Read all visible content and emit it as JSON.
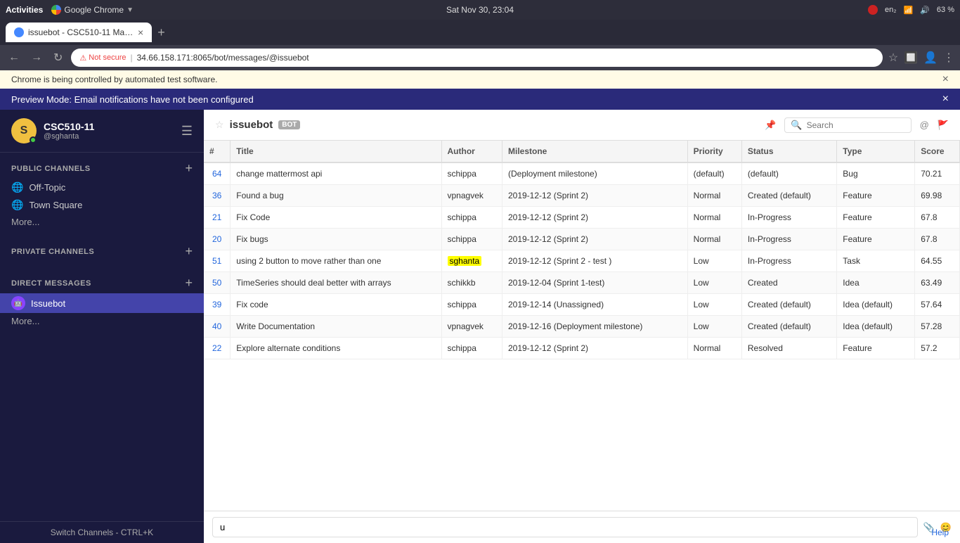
{
  "os": {
    "activities": "Activities",
    "browser_name": "Google Chrome",
    "datetime": "Sat Nov 30, 23:04",
    "battery": "63 %",
    "language": "en₂"
  },
  "browser": {
    "tab_title": "issuebot - CSC510-11 Mat...",
    "tab_close": "×",
    "new_tab": "+",
    "back": "←",
    "forward": "→",
    "reload": "↻",
    "not_secure_label": "Not secure",
    "url": "34.66.158.171:8065/bot/messages/@issuebot",
    "warning_icon": "⚠",
    "separator": "|"
  },
  "notifications": {
    "automation_text": "Chrome is being controlled by automated test software.",
    "automation_close": "×",
    "preview_text": "Preview Mode: Email notifications have not been configured",
    "preview_close": "×"
  },
  "sidebar": {
    "workspace_name": "CSC510-11",
    "username": "@sghanta",
    "avatar_letter": "S",
    "hamburger": "☰",
    "public_channels_label": "PUBLIC CHANNELS",
    "channels": [
      {
        "icon": "🌐",
        "name": "Off-Topic"
      },
      {
        "icon": "🌐",
        "name": "Town Square"
      }
    ],
    "more_label": "More...",
    "private_channels_label": "PRIVATE CHANNELS",
    "direct_messages_label": "DIRECT MESSAGES",
    "direct_messages": [
      {
        "name": "Issuebot",
        "icon": "🤖",
        "active": true
      }
    ],
    "dm_more_label": "More...",
    "switch_channels": "Switch Channels - CTRL+K"
  },
  "channel": {
    "name": "issuebot",
    "bot_badge": "BOT",
    "search_placeholder": "Search"
  },
  "table": {
    "headers": [
      "#",
      "Title",
      "Author",
      "Milestone",
      "Priority",
      "Status",
      "Type",
      "Score"
    ],
    "rows": [
      {
        "id": "64",
        "title": "change mattermost api",
        "author": "schippa",
        "milestone": "(Deployment milestone)",
        "milestone_sub": "",
        "priority": "(default)",
        "status": "(default)",
        "type": "Bug",
        "score": "70.21",
        "highlight_author": false
      },
      {
        "id": "36",
        "title": "Found a bug",
        "author": "vpnagvek",
        "milestone": "2019-12-12 (Sprint 2)",
        "milestone_sub": "",
        "priority": "Normal",
        "status": "Created (default)",
        "type": "Feature",
        "score": "69.98",
        "highlight_author": false
      },
      {
        "id": "21",
        "title": "Fix Code",
        "author": "schippa",
        "milestone": "2019-12-12 (Sprint 2)",
        "milestone_sub": "",
        "priority": "Normal",
        "status": "In-Progress",
        "type": "Feature",
        "score": "67.8",
        "highlight_author": false
      },
      {
        "id": "20",
        "title": "Fix bugs",
        "author": "schippa",
        "milestone": "2019-12-12 (Sprint 2)",
        "milestone_sub": "",
        "priority": "Normal",
        "status": "In-Progress",
        "type": "Feature",
        "score": "67.8",
        "highlight_author": false
      },
      {
        "id": "51",
        "title": "using 2 button to move rather than one",
        "author": "sghanta",
        "milestone": "2019-12-12 (Sprint 2 - test )",
        "milestone_sub": "",
        "priority": "Low",
        "status": "In-Progress",
        "type": "Task",
        "score": "64.55",
        "highlight_author": true
      },
      {
        "id": "50",
        "title": "TimeSeries should deal better with arrays",
        "author": "schikkb",
        "milestone": "2019-12-04 (Sprint 1-test)",
        "milestone_sub": "",
        "priority": "Low",
        "status": "Created",
        "type": "Idea",
        "score": "63.49",
        "highlight_author": false
      },
      {
        "id": "39",
        "title": "Fix code",
        "author": "schippa",
        "milestone": "2019-12-14 (Unassigned)",
        "milestone_sub": "",
        "priority": "Low",
        "status": "Created (default)",
        "type": "Idea (default)",
        "score": "57.64",
        "highlight_author": false
      },
      {
        "id": "40",
        "title": "Write Documentation",
        "author": "vpnagvek",
        "milestone": "2019-12-16 (Deployment milestone)",
        "milestone_sub": "",
        "priority": "Low",
        "status": "Created (default)",
        "type": "Idea (default)",
        "score": "57.28",
        "highlight_author": false
      },
      {
        "id": "22",
        "title": "Explore alternate conditions",
        "author": "schippa",
        "milestone": "2019-12-12 (Sprint 2)",
        "milestone_sub": "",
        "priority": "Normal",
        "status": "Resolved",
        "type": "Feature",
        "score": "57.2",
        "highlight_author": false
      }
    ]
  },
  "message_input": {
    "value": "u",
    "placeholder": ""
  },
  "footer": {
    "help_label": "Help"
  }
}
